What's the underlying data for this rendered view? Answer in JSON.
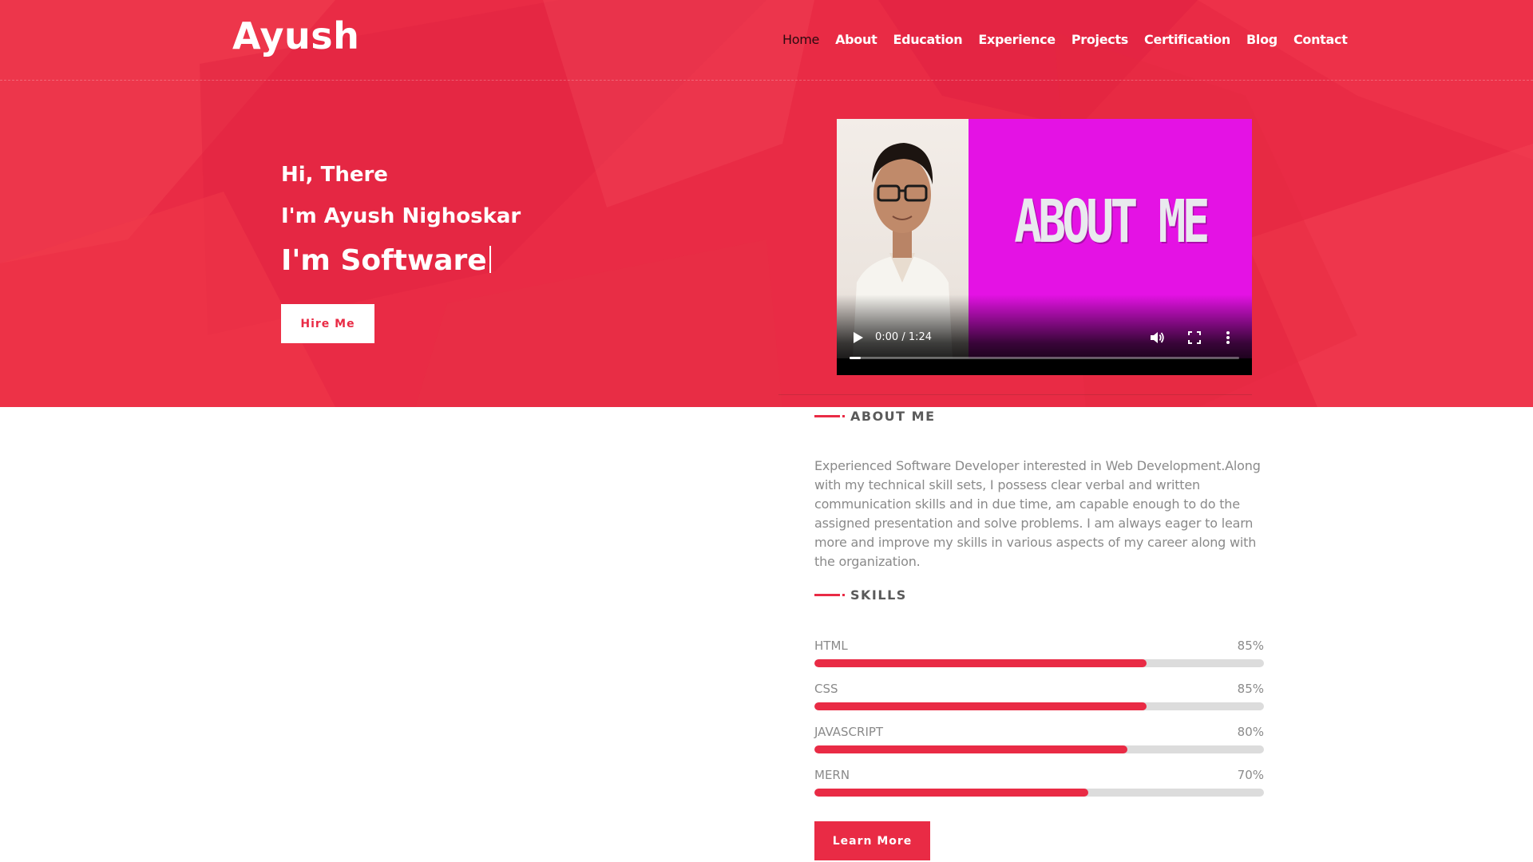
{
  "header": {
    "brand": "Ayush",
    "nav": [
      "Home",
      "About",
      "Education",
      "Experience",
      "Projects",
      "Certification",
      "Blog",
      "Contact"
    ],
    "active_nav": "Home"
  },
  "hero": {
    "greeting_line1": "Hi, There",
    "greeting_line2": "I'm Ayush Nighoskar",
    "greeting_line3": "I'm Software",
    "hire_button": "Hire Me"
  },
  "video": {
    "title_text": "ABOUT ME",
    "time": "0:00 / 1:24",
    "progress": 0.0
  },
  "about": {
    "heading": "ABOUT ME",
    "text": "Experienced Software Developer interested in Web Development.Along with my technical skill sets, I possess clear verbal and written communication skills and in due time, am capable enough to do the assigned presentation and solve problems. I am always eager to learn more and improve my skills in various aspects of my career along with the organization."
  },
  "skills": {
    "heading": "SKILLS",
    "items": [
      {
        "name": "HTML",
        "percent_label": "85%",
        "level": 0.85
      },
      {
        "name": "CSS",
        "percent_label": "85%",
        "level": 0.85
      },
      {
        "name": "JAVASCRIPT",
        "percent_label": "80%",
        "level": 0.8
      },
      {
        "name": "MERN",
        "percent_label": "70%",
        "level": 0.7
      }
    ]
  },
  "learn_more_button": "Learn More",
  "colors": {
    "accent": "#e92b45",
    "video_background": "#e412e4"
  }
}
